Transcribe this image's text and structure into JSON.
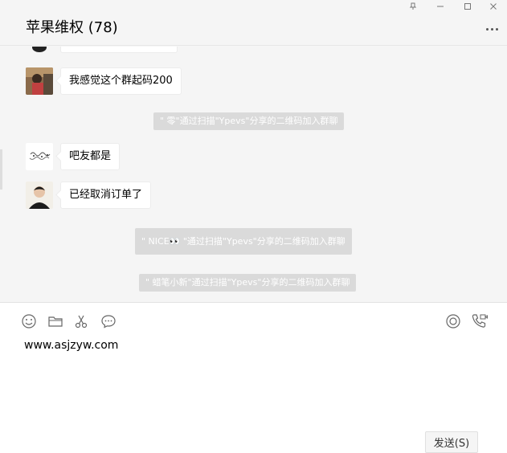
{
  "header": {
    "title": "苹果维权 (78)"
  },
  "window_controls": {
    "pin_icon": "pin-icon",
    "minimize_icon": "minimize-icon",
    "maximize_icon": "maximize-icon",
    "close_icon": "close-icon",
    "more_icon": "more-icon"
  },
  "messages": [
    {
      "type": "text",
      "text": "我感觉这个群起码200"
    },
    {
      "type": "system",
      "text": "\" 零\"通过扫描\"Ypevs\"分享的二维码加入群聊"
    },
    {
      "type": "text",
      "text": "吧友都是"
    },
    {
      "type": "text",
      "text": "已经取消订单了"
    },
    {
      "type": "system",
      "text": "\" NICE👀 \"通过扫描\"Ypevs\"分享的二维码加入群聊"
    },
    {
      "type": "system",
      "text": "\" 蜡笔小新\"通过扫描\"Ypevs\"分享的二维码加入群聊"
    }
  ],
  "toolbar": {
    "emoji_icon": "emoji-icon",
    "folder_icon": "folder-icon",
    "screenshot_icon": "scissors-icon",
    "chat_history_icon": "chat-bubble-icon",
    "live_icon": "live-circle-icon",
    "call_icon": "phone-video-icon"
  },
  "composer": {
    "value": "www.asjzyw.com",
    "send_label": "发送(S)"
  }
}
